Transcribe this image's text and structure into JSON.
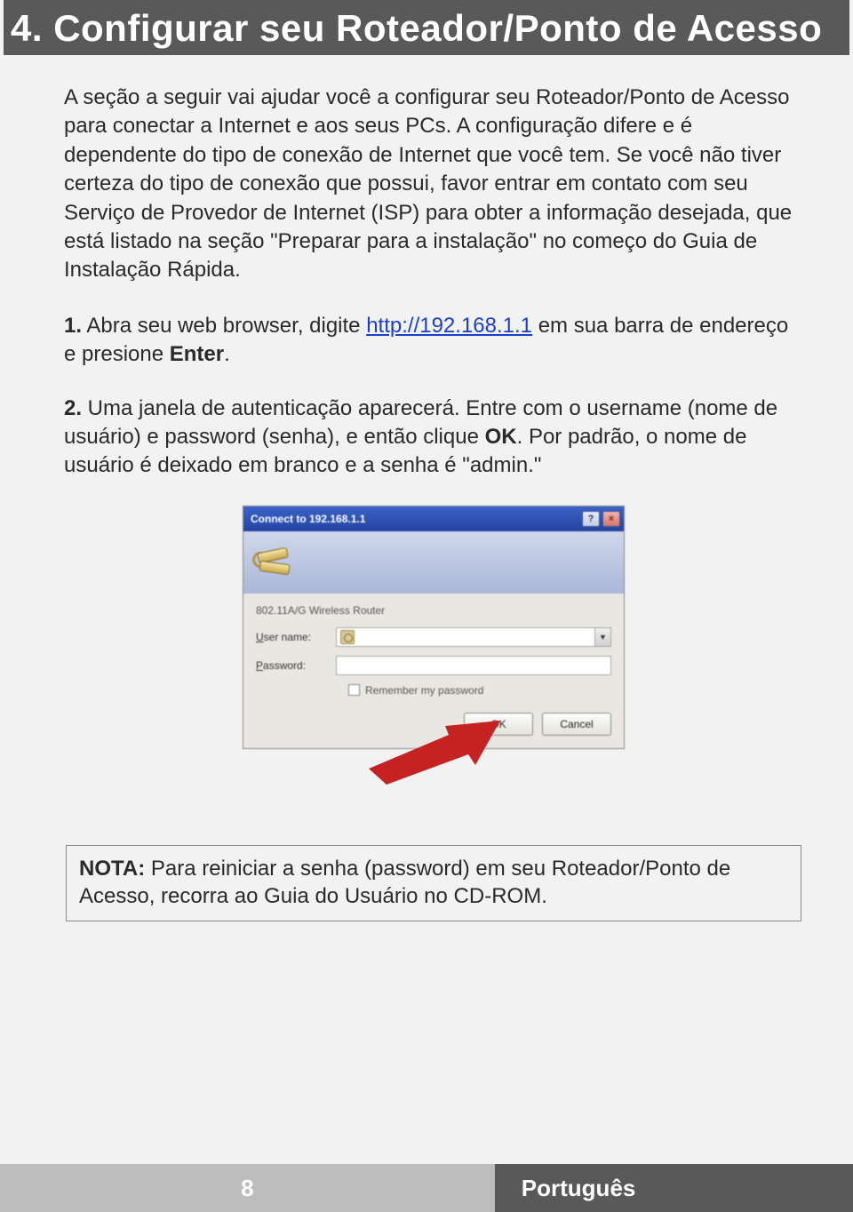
{
  "header": {
    "title": "4. Configurar seu Roteador/Ponto de Acesso"
  },
  "intro": "A seção a seguir vai ajudar você a configurar seu Roteador/Ponto de Acesso para conectar a Internet e aos seus PCs. A configuração difere e é dependente do tipo de conexão de Internet que você tem. Se você não tiver certeza do tipo de conexão que possui, favor entrar em contato com seu Serviço de Provedor de Internet (ISP) para obter a informação desejada, que está listado na seção \"Preparar para a instalação\" no começo do Guia de Instalação Rápida.",
  "step1": {
    "num": "1.",
    "pre": " Abra seu web browser, digite ",
    "url": "http://192.168.1.1",
    "post": " em sua barra de endereço e presione ",
    "key": "Enter",
    "tail": "."
  },
  "step2": {
    "num": "2.",
    "pre": " Uma janela de autenticação aparecerá. Entre com o username (nome de usuário) e password (senha), e então clique ",
    "key": "OK",
    "post": ". Por padrão, o nome de usuário é deixado em branco e a senha é \"admin.\""
  },
  "dialog": {
    "title": "Connect to 192.168.1.1",
    "help": "?",
    "close": "×",
    "realm": "802.11A/G Wireless Router",
    "user_label_pre": "U",
    "user_label": "ser name:",
    "user_value": "",
    "pass_label_pre": "P",
    "pass_label": "assword:",
    "remember_pre": "R",
    "remember": "emember my password",
    "ok": "OK",
    "cancel": "Cancel"
  },
  "note": {
    "label": "NOTA:",
    "text": " Para reiniciar a senha (password) em seu Roteador/Ponto de Acesso, recorra ao Guia do Usuário no CD-ROM."
  },
  "footer": {
    "page": "8",
    "lang": "Português"
  }
}
